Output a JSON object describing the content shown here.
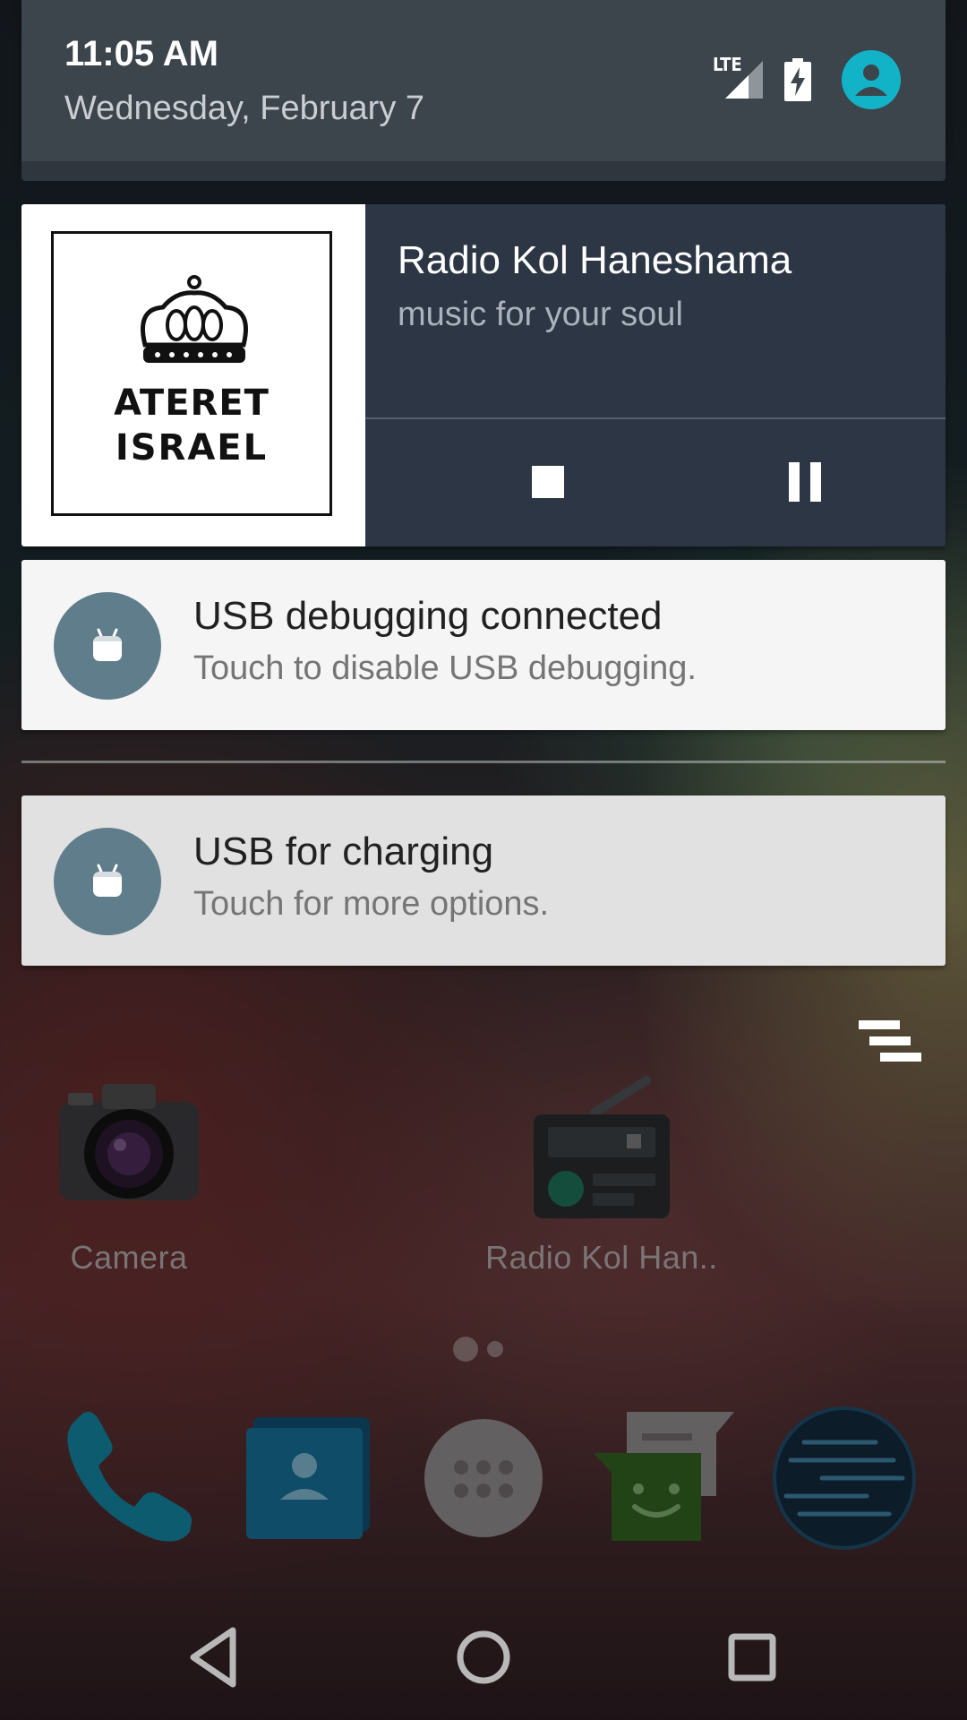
{
  "header": {
    "time": "11:05 AM",
    "date": "Wednesday, February 7",
    "network_label": "LTE",
    "accent_color": "#13b3c7"
  },
  "media": {
    "title": "Radio Kol Haneshama",
    "subtitle": "music for your soul",
    "album_art": {
      "logo_line1": "ATERET",
      "logo_line2": "ISRAEL"
    },
    "controls": [
      "stop-icon",
      "pause-icon"
    ]
  },
  "notifications": [
    {
      "title": "USB debugging connected",
      "text": "Touch to disable USB debugging."
    },
    {
      "title": "USB for charging",
      "text": "Touch for more options."
    }
  ],
  "desktop": {
    "apps": [
      {
        "label": "Camera",
        "icon": "camera-icon"
      },
      {
        "label": "Radio Kol Han..",
        "icon": "radio-icon"
      }
    ],
    "page_count": 2,
    "current_page": 1
  },
  "dock": [
    "phone-icon",
    "contacts-icon",
    "app-drawer-icon",
    "messaging-icon",
    "browser-icon"
  ],
  "nav": [
    "back-icon",
    "home-icon",
    "recents-icon"
  ]
}
